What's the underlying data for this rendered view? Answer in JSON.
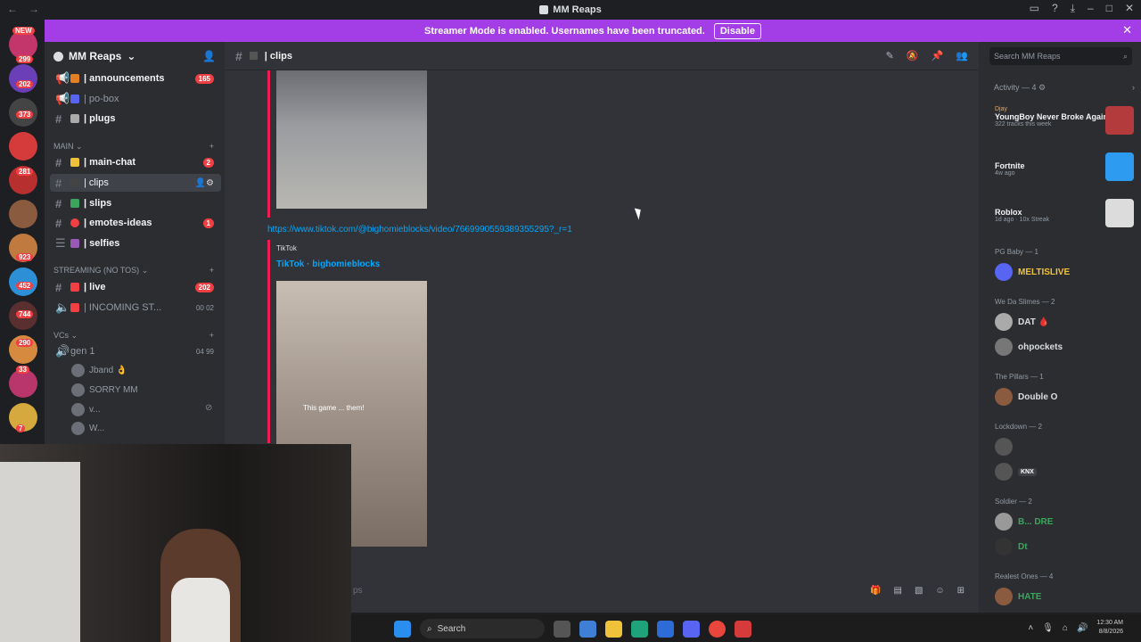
{
  "app": {
    "window_title": "MM Reaps",
    "banner_text": "Streamer Mode is enabled. Usernames have been truncated.",
    "banner_button": "Disable"
  },
  "guild_badges": [
    "NEW",
    "299",
    "202",
    "373",
    "281",
    "923",
    "452",
    "744",
    "290",
    "33",
    "7"
  ],
  "server": {
    "name": "MM Reaps",
    "channels_top": [
      {
        "name": "| announcements",
        "count": "165"
      },
      {
        "name": "| po-box"
      },
      {
        "name": "| plugs"
      }
    ],
    "cat_main": "MAIN",
    "channels_main": [
      {
        "name": "| main-chat",
        "count": "2"
      },
      {
        "name": "| clips"
      },
      {
        "name": "| slips"
      },
      {
        "name": "| emotes-ideas",
        "count": "1"
      },
      {
        "name": "| selfies"
      }
    ],
    "cat_streaming": "STREAMING (NO TOS)",
    "channels_streaming": [
      {
        "name": "| live",
        "count": "202"
      },
      {
        "name": "| INCOMING ST...",
        "time": "00 02"
      }
    ],
    "cat_vcs": "VCs",
    "vc": {
      "name": "gen 1",
      "time": "04 99"
    },
    "vc_users": [
      "Jband 👌",
      "SORRY MM",
      "v...",
      "W..."
    ]
  },
  "channel": {
    "name": "| clips",
    "link": "https://www.tiktok.com/@bighomieblocks/video/7669990559389355295?_r=1",
    "embed_provider": "TikTok",
    "embed_title": "TikTok · bighomieblocks",
    "caption": "This game ... them!",
    "composer_placeholder": "ps"
  },
  "members": {
    "search_placeholder": "Search MM Reaps",
    "activity_header": "Activity — 4",
    "activities": [
      {
        "who": "Djay",
        "what": "YoungBoy Never Broke Again",
        "sub": "322 tracks this week",
        "color": "#b33b3b"
      },
      {
        "who": "",
        "what": "Fortnite",
        "sub": "4w ago",
        "color": "#2d9bf0"
      },
      {
        "who": "",
        "what": "Roblox",
        "sub": "1d ago · 10x Streak",
        "color": "#dcdcdc"
      }
    ],
    "groups": [
      {
        "role": "PG Baby — 1",
        "members": [
          {
            "name": "MELTISLIVE",
            "color": "#f0c23a"
          }
        ]
      },
      {
        "role": "We Da Slimes — 2",
        "members": [
          {
            "name": "DAT 🩸",
            "color": "#ffffff"
          },
          {
            "name": "ohpockets",
            "color": "#ffffff"
          }
        ]
      },
      {
        "role": "The Pillars — 1",
        "members": [
          {
            "name": "Double O",
            "color": "#ffffff"
          }
        ]
      },
      {
        "role": "Lockdown — 2",
        "members": [
          {
            "name": "",
            "color": "#ffffff"
          },
          {
            "name": "KNX",
            "color": "#ffffff"
          }
        ]
      },
      {
        "role": "Soldier — 2",
        "members": [
          {
            "name": "B... DRE",
            "color": "#3ba55d"
          },
          {
            "name": "Dt",
            "color": "#3ba55d"
          }
        ]
      },
      {
        "role": "Realest Ones — 4",
        "members": [
          {
            "name": "HATE",
            "color": "#3ba55d"
          }
        ]
      }
    ]
  },
  "taskbar": {
    "search": "Search",
    "time": "12:30 AM",
    "date": "8/8/2026"
  }
}
